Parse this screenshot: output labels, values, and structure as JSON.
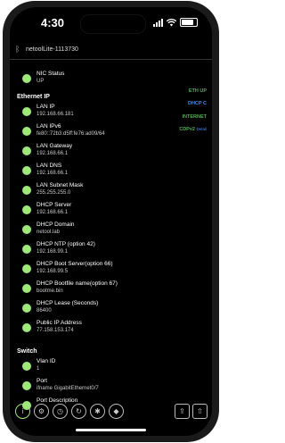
{
  "status_bar": {
    "time": "4:30"
  },
  "app": {
    "device_name": "netoolLite-1113730"
  },
  "status_tags": {
    "eth": "ETH UP",
    "dhcp": "DHCP",
    "dhcp_icon": "C",
    "internet": "INTERNET",
    "cdp": "CDPv2",
    "cdp_detail": "Detail"
  },
  "nic": {
    "label": "NIC Status",
    "value": "UP"
  },
  "sections": {
    "ethernet_ip": "Ethernet IP",
    "switch": "Switch"
  },
  "ethernet_rows": [
    {
      "label": "LAN IP",
      "value": "192.168.66.181"
    },
    {
      "label": "LAN IPv6",
      "value": "fe80::72b3:d5ff:fe76:ad09/64"
    },
    {
      "label": "LAN Gateway",
      "value": "192.168.66.1"
    },
    {
      "label": "LAN DNS",
      "value": "192.168.66.1"
    },
    {
      "label": "LAN Subnet Mask",
      "value": "255.255.255.0"
    },
    {
      "label": "DHCP Server",
      "value": "192.168.66.1"
    },
    {
      "label": "DHCP Domain",
      "value": "netool.lab"
    },
    {
      "label": "DHCP NTP (option 42)",
      "value": "192.168.99.1"
    },
    {
      "label": "DHCP Boot Server(option 66)",
      "value": "192.168.99.5"
    },
    {
      "label": "DHCP Bootfile name(option 67)",
      "value": "bootme.bin"
    },
    {
      "label": "DHCP Lease (Seconds)",
      "value": "86400"
    },
    {
      "label": "Public IP Address",
      "value": "77.158.153.174"
    }
  ],
  "switch_rows": [
    {
      "label": "Vlan ID",
      "value": "1"
    },
    {
      "label": "Port",
      "value": "ifname GigabitEthernet0/7"
    },
    {
      "label": "Port Description",
      "value": ""
    }
  ],
  "toolbar": {
    "info": "i",
    "settings": "⚙",
    "history": "◷",
    "refresh": "↻",
    "asterisk": "✱",
    "tag": "◆",
    "share": "⇪",
    "export": "⇧"
  }
}
